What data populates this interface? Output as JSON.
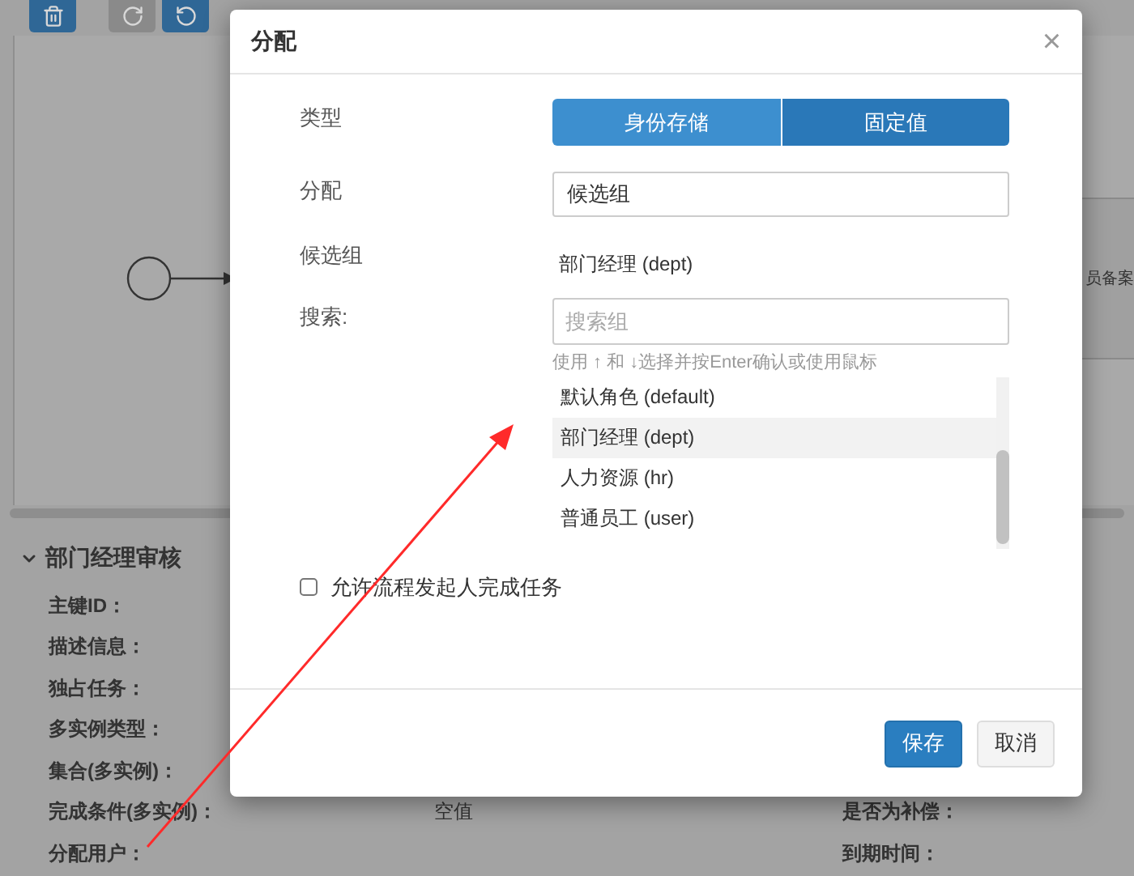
{
  "toolbar": [
    {
      "kind": "delete",
      "disabled": false
    },
    {
      "kind": "redo",
      "disabled": true
    },
    {
      "kind": "undo",
      "disabled": false
    }
  ],
  "canvas": {
    "node_label": "员备案"
  },
  "properties": {
    "title": "部门经理审核",
    "rows": [
      {
        "label": "主键ID："
      },
      {
        "label": "描述信息："
      },
      {
        "label": "独占任务："
      },
      {
        "label": "多实例类型："
      },
      {
        "label": "集合(多实例)："
      },
      {
        "label": "完成条件(多实例)：",
        "value": "空值",
        "right_label": "是否为补偿："
      },
      {
        "label": "分配用户：",
        "right_label": "到期时间："
      }
    ]
  },
  "dialog": {
    "title": "分配",
    "close": "×",
    "type": {
      "label": "类型",
      "options": [
        {
          "label": "身份存储",
          "selected": true
        },
        {
          "label": "固定值",
          "selected": false
        }
      ]
    },
    "assign": {
      "label": "分配",
      "value": "候选组"
    },
    "candidates": {
      "label": "候选组",
      "value": "部门经理 (dept)"
    },
    "search": {
      "label": "搜索:",
      "placeholder": "搜索组",
      "hint": "使用 ↑ 和 ↓选择并按Enter确认或使用鼠标",
      "results": [
        {
          "label": "默认角色 (default)",
          "selected": false
        },
        {
          "label": "部门经理 (dept)",
          "selected": true
        },
        {
          "label": "人力资源 (hr)",
          "selected": false
        },
        {
          "label": "普通员工 (user)",
          "selected": false
        }
      ]
    },
    "initiator": {
      "label": "允许流程发起人完成任务",
      "checked": false
    },
    "buttons": [
      {
        "label": "保存",
        "kind": "primary"
      },
      {
        "label": "取消",
        "kind": "default"
      }
    ]
  }
}
